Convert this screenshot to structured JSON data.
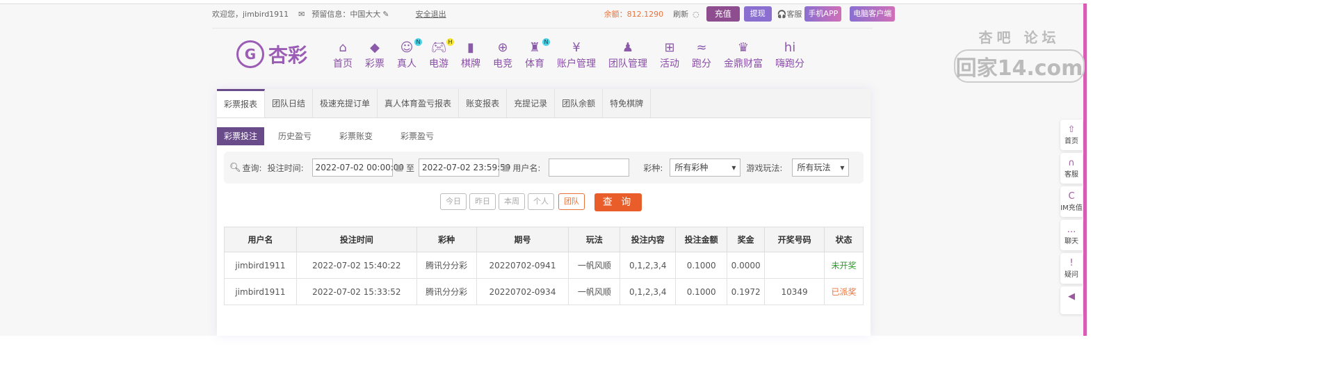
{
  "topbar": {
    "welcome": "欢迎您，jimbird1911",
    "reserved_info": "预留信息：中国大大",
    "logout": "安全退出",
    "balance": "余额：812.1290",
    "refresh": "刷新",
    "recharge": "充值",
    "withdraw": "提现",
    "service": "客服",
    "mobile_app": "手机APP",
    "pc_client": "电脑客户端"
  },
  "logo": {
    "text": "杏彩"
  },
  "nav": [
    {
      "label": "首页",
      "icon": "home-icon"
    },
    {
      "label": "彩票",
      "icon": "ticket-icon"
    },
    {
      "label": "真人",
      "icon": "dealer-icon",
      "badge": "N"
    },
    {
      "label": "电游",
      "icon": "gamepad-icon",
      "badge": "H"
    },
    {
      "label": "棋牌",
      "icon": "cards-icon"
    },
    {
      "label": "电竞",
      "icon": "controller-icon"
    },
    {
      "label": "体育",
      "icon": "trophy-icon",
      "badge": "N"
    },
    {
      "label": "账户管理",
      "icon": "yen-icon"
    },
    {
      "label": "团队管理",
      "icon": "team-icon"
    },
    {
      "label": "活动",
      "icon": "gift-icon"
    },
    {
      "label": "跑分",
      "icon": "rhino-icon"
    },
    {
      "label": "金鼎财富",
      "icon": "ding-icon"
    },
    {
      "label": "嗨跑分",
      "icon": "hi-icon"
    }
  ],
  "tabs": [
    "彩票报表",
    "团队日结",
    "极速充提订单",
    "真人体育盈亏报表",
    "账变报表",
    "充提记录",
    "团队余额",
    "特免棋牌"
  ],
  "subtabs": [
    "彩票投注",
    "历史盈亏",
    "彩票账变",
    "彩票盈亏"
  ],
  "filter": {
    "query_label": "查询:",
    "time_label": "投注时间:",
    "start": "2022-07-02 00:00:00",
    "to": "至",
    "end": "2022-07-02 23:59:59",
    "user_label": "用户名:",
    "user_value": "",
    "lottery_label": "彩种:",
    "lottery_value": "所有彩种",
    "play_label": "游戏玩法:",
    "play_value": "所有玩法"
  },
  "quick": [
    "今日",
    "昨日",
    "本周",
    "个人",
    "团队"
  ],
  "search_label": "查 询",
  "table": {
    "headers": [
      "用户名",
      "投注时间",
      "彩种",
      "期号",
      "玩法",
      "投注内容",
      "投注金额",
      "奖金",
      "开奖号码",
      "状态"
    ],
    "rows": [
      [
        "jimbird1911",
        "2022-07-02 15:40:22",
        "腾讯分分彩",
        "20220702-0941",
        "一帆风顺",
        "0,1,2,3,4",
        "0.1000",
        "0.0000",
        "",
        "未开奖"
      ],
      [
        "jimbird1911",
        "2022-07-02 15:33:52",
        "腾讯分分彩",
        "20220702-0934",
        "一帆风顺",
        "0,1,2,3,4",
        "0.1000",
        "0.1972",
        "10349",
        "已派奖"
      ]
    ]
  },
  "side": [
    {
      "label": "首页",
      "icon": "arrow-up-icon"
    },
    {
      "label": "客服",
      "icon": "headset-icon"
    },
    {
      "label": "IM充值",
      "icon": "im-icon"
    },
    {
      "label": "聊天",
      "icon": "chat-icon"
    },
    {
      "label": "疑问",
      "icon": "alert-icon"
    }
  ],
  "watermark": {
    "line1": "杏吧 论坛",
    "line2": "回家14.com"
  },
  "colors": {
    "accent": "#6a4b8a",
    "balance": "#e8733b",
    "search": "#e85d2a",
    "pending": "#2e9a2e",
    "paid": "#e8733b"
  }
}
